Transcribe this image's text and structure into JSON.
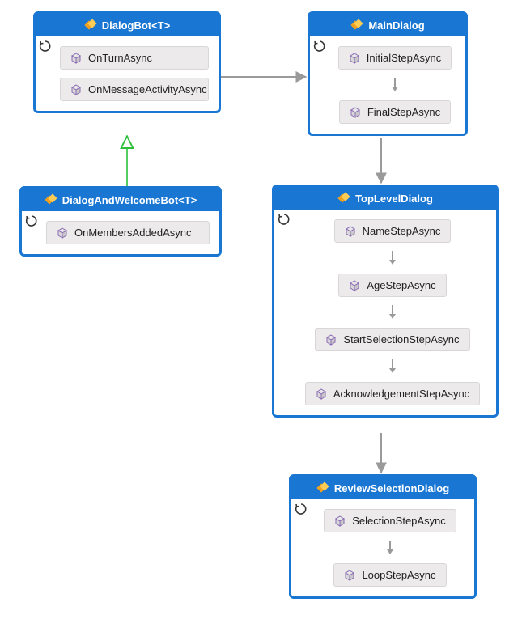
{
  "boxes": {
    "dialogBot": {
      "title": "DialogBot<T>",
      "methods": [
        "OnTurnAsync",
        "OnMessageActivityAsync"
      ]
    },
    "dialogAndWelcomeBot": {
      "title": "DialogAndWelcomeBot<T>",
      "methods": [
        "OnMembersAddedAsync"
      ]
    },
    "mainDialog": {
      "title": "MainDialog",
      "methods": [
        "InitialStepAsync",
        "FinalStepAsync"
      ]
    },
    "topLevelDialog": {
      "title": "TopLevelDialog",
      "methods": [
        "NameStepAsync",
        "AgeStepAsync",
        "StartSelectionStepAsync",
        "AcknowledgementStepAsync"
      ]
    },
    "reviewSelectionDialog": {
      "title": "ReviewSelectionDialog",
      "methods": [
        "SelectionStepAsync",
        "LoopStepAsync"
      ]
    }
  }
}
